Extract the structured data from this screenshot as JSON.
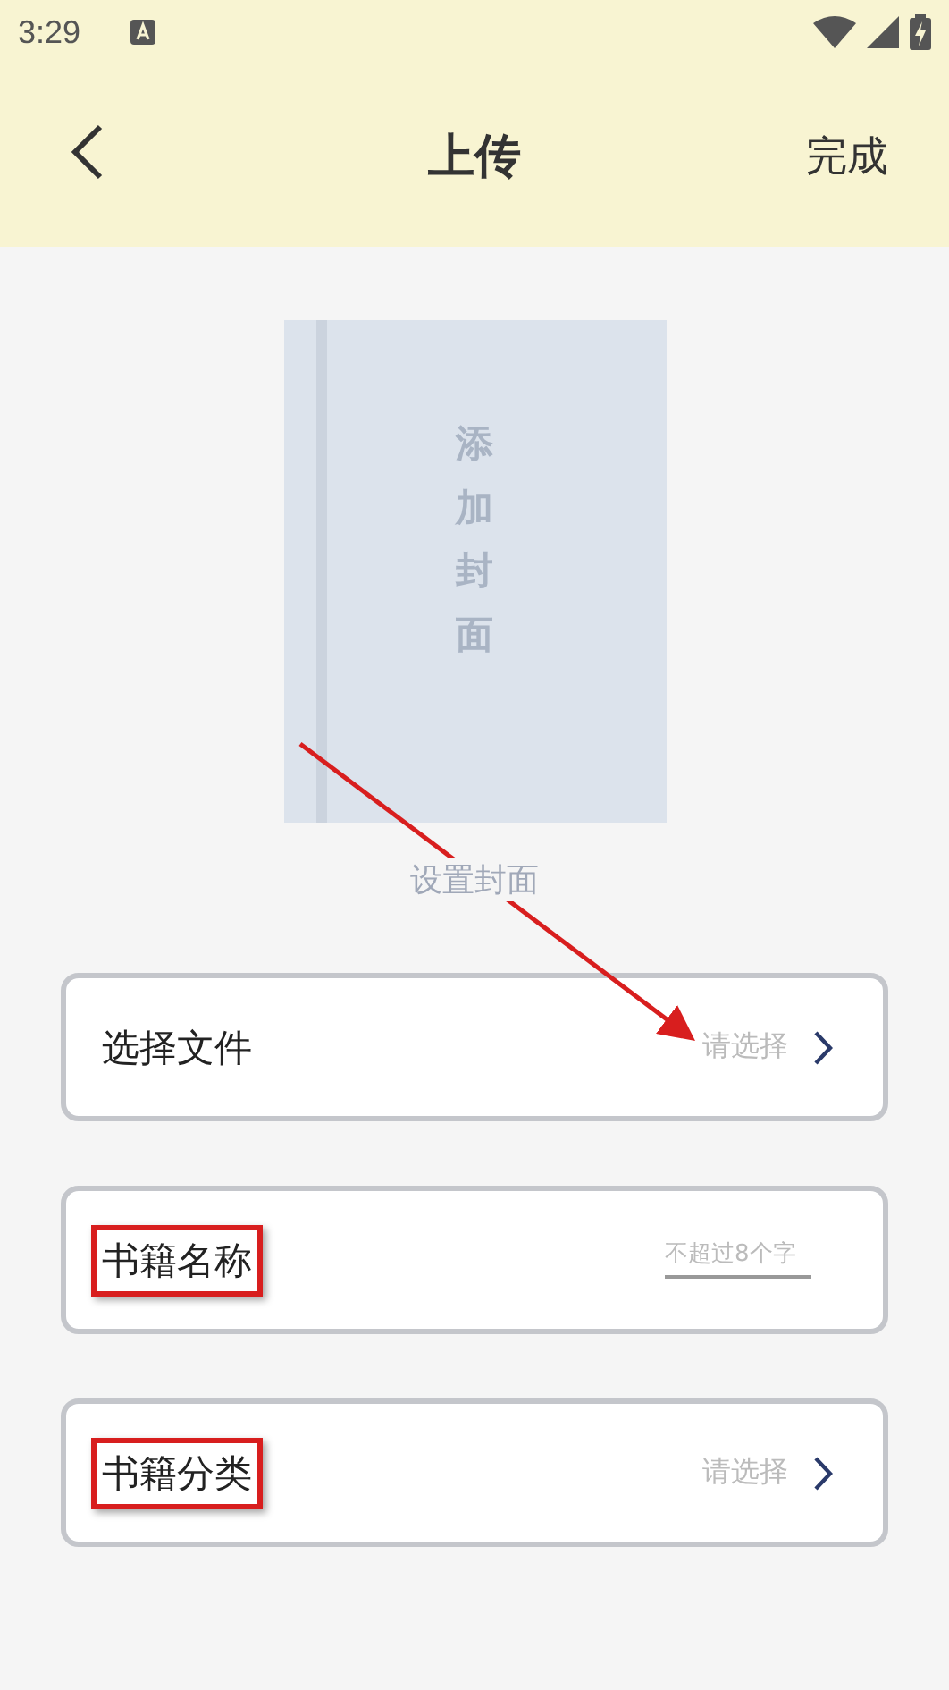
{
  "status_bar": {
    "time": "3:29"
  },
  "header": {
    "title": "上传",
    "action": "完成"
  },
  "cover": {
    "placeholder": "添加封面",
    "caption": "设置封面"
  },
  "rows": [
    {
      "kind": "select",
      "label": "选择文件",
      "value": "请选择",
      "highlighted": false
    },
    {
      "kind": "input",
      "label": "书籍名称",
      "placeholder": "不超过8个字",
      "highlighted": true
    },
    {
      "kind": "select",
      "label": "书籍分类",
      "value": "请选择",
      "highlighted": true
    }
  ],
  "annotation_arrow": true
}
